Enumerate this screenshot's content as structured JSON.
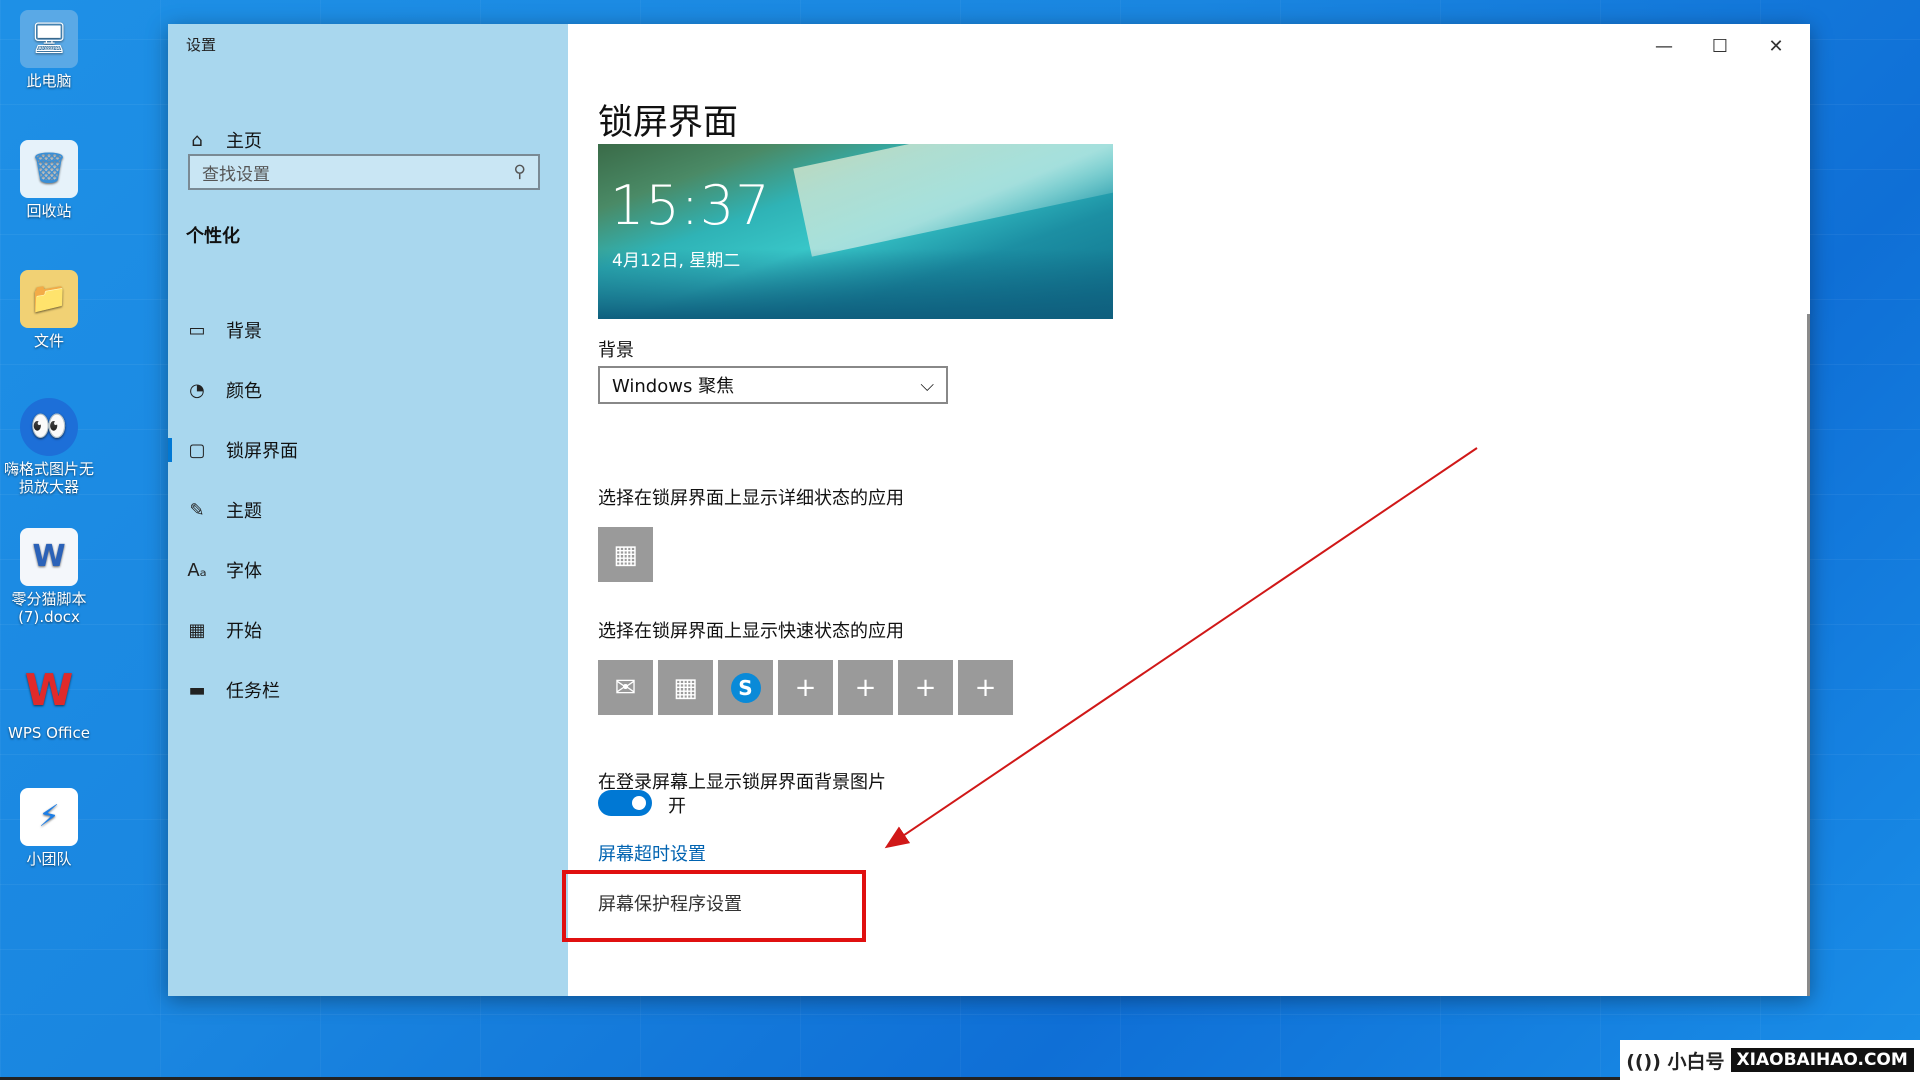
{
  "desktop": {
    "icons": [
      {
        "label": "此电脑",
        "glyph": "🖥"
      },
      {
        "label": "回收站",
        "glyph": "🗑"
      },
      {
        "label": "文件",
        "glyph": "📁"
      },
      {
        "label": "嗨格式图片无损放大器",
        "glyph": "👀"
      },
      {
        "label": "零分猫脚本(7).docx",
        "glyph": "W"
      },
      {
        "label": "WPS Office",
        "glyph": "W"
      },
      {
        "label": "小团队",
        "glyph": "⚡"
      }
    ]
  },
  "window": {
    "title": "设置",
    "minimize_glyph": "—",
    "maximize_glyph": "☐",
    "close_glyph": "✕"
  },
  "sidebar": {
    "home_label": "主页",
    "search_placeholder": "查找设置",
    "section": "个性化",
    "items": [
      {
        "label": "背景",
        "icon": "image-icon"
      },
      {
        "label": "颜色",
        "icon": "palette-icon"
      },
      {
        "label": "锁屏界面",
        "icon": "lockscreen-icon"
      },
      {
        "label": "主题",
        "icon": "theme-icon"
      },
      {
        "label": "字体",
        "icon": "font-icon"
      },
      {
        "label": "开始",
        "icon": "start-icon"
      },
      {
        "label": "任务栏",
        "icon": "taskbar-icon"
      }
    ]
  },
  "content": {
    "title": "锁屏界面",
    "preview": {
      "time": "15:37",
      "date": "4月12日, 星期二"
    },
    "background_label": "背景",
    "background_value": "Windows 聚焦",
    "detailed_app_label": "选择在锁屏界面上显示详细状态的应用",
    "quick_apps_label": "选择在锁屏界面上显示快速状态的应用",
    "quick_apps": [
      "mail-icon",
      "calendar-icon",
      "skype-icon",
      "plus-icon",
      "plus-icon",
      "plus-icon",
      "plus-icon"
    ],
    "login_bg_label": "在登录屏幕上显示锁屏界面背景图片",
    "toggle_state": "开",
    "screen_timeout_link": "屏幕超时设置",
    "screensaver_link": "屏幕保护程序设置"
  },
  "watermark": {
    "brand_text": "(()) 小白号",
    "brand_url": "XIAOBAIHAO.COM"
  },
  "colors": {
    "accent": "#0078d4",
    "highlight": "#e01010",
    "sidebar": "#a9d7ee"
  }
}
